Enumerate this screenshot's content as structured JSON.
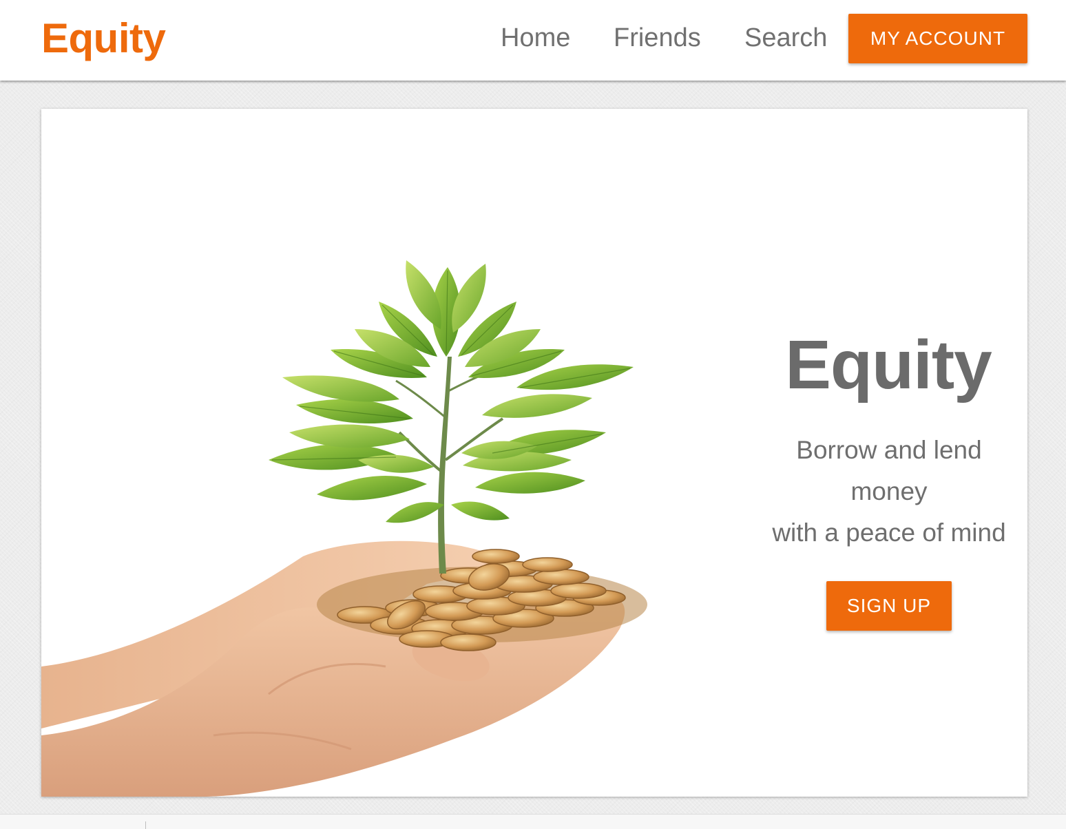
{
  "theme": {
    "accent": "#ee6a0c",
    "nav_text": "#707070",
    "heading_text": "#6b6b6b"
  },
  "navbar": {
    "brand": "Equity",
    "links": [
      "Home",
      "Friends",
      "Search"
    ],
    "account_button": "MY ACCOUNT"
  },
  "hero": {
    "title": "Equity",
    "subtitle_lines": [
      "Borrow and lend",
      "money",
      "with a peace of mind"
    ],
    "cta_button": "SIGN UP",
    "image": "hands-holding-coins-with-sapling"
  }
}
